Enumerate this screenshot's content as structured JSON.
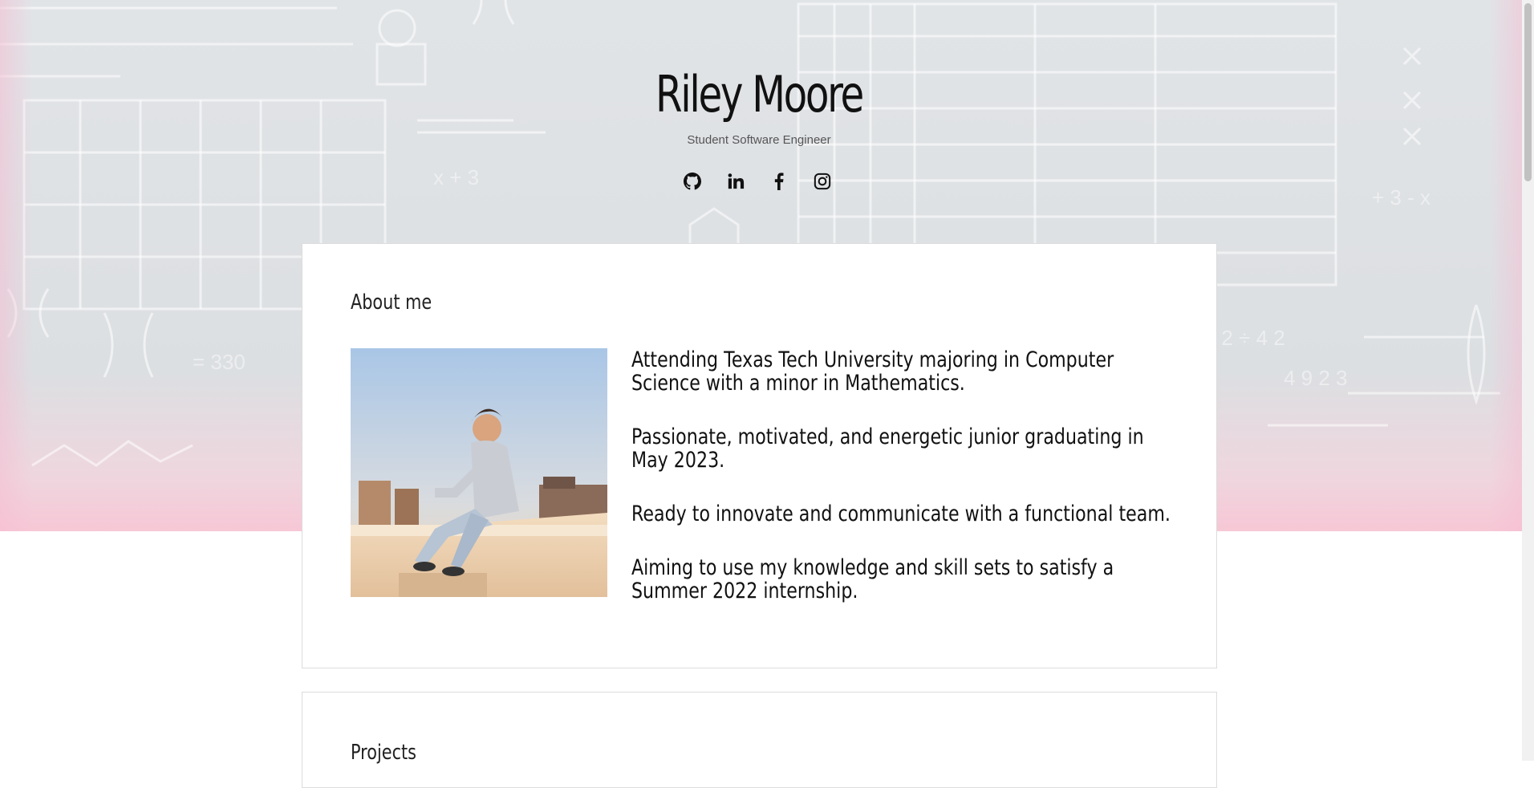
{
  "header": {
    "name": "Riley Moore",
    "subtitle": "Student Software Engineer",
    "socials": [
      {
        "icon": "github-icon"
      },
      {
        "icon": "linkedin-icon"
      },
      {
        "icon": "facebook-icon"
      },
      {
        "icon": "instagram-icon"
      }
    ]
  },
  "about": {
    "title": "About me",
    "paragraphs": [
      "Attending Texas Tech University majoring in Computer Science with a minor in Mathematics.",
      "Passionate, motivated, and energetic junior graduating in May 2023.",
      "Ready to innovate and communicate with a functional team.",
      "Aiming to use my knowledge and skill sets to satisfy a Summer 2022 internship."
    ]
  },
  "projects": {
    "title": "Projects"
  },
  "colors": {
    "hero_gray": "#dcdfe2",
    "hero_pink": "#f7c7d6",
    "text": "#111111"
  }
}
